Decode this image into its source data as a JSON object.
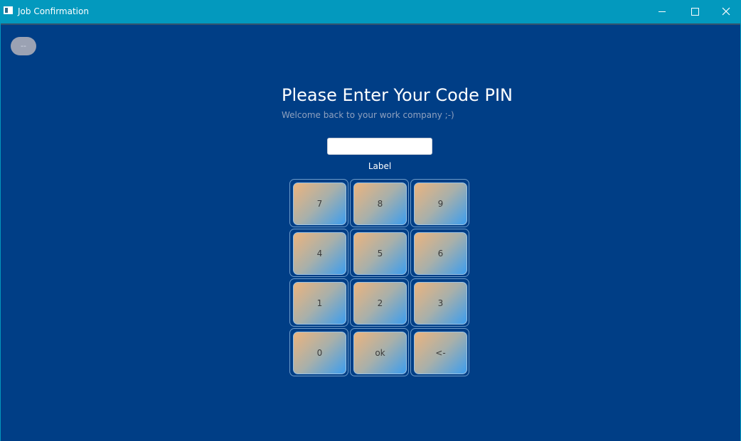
{
  "window": {
    "title": "Job Confirmation",
    "icon": "app-window-icon",
    "controls": [
      "minimize-icon",
      "maximize-icon",
      "close-icon"
    ]
  },
  "menu_button": {
    "label": "--"
  },
  "header": {
    "title": "Please Enter Your Code PIN",
    "subtitle": "Welcome back to your work company ;-)"
  },
  "pin": {
    "value": "",
    "placeholder": "",
    "label": "Label"
  },
  "keypad": {
    "rows": [
      [
        "7",
        "8",
        "9"
      ],
      [
        "4",
        "5",
        "6"
      ],
      [
        "1",
        "2",
        "3"
      ],
      [
        "0",
        "ok",
        "<-"
      ]
    ]
  },
  "colors": {
    "title_bar": "#0399be",
    "background": "#003e86",
    "key_gradient_start": "#ecb47e",
    "key_gradient_end": "#3d9ded"
  }
}
